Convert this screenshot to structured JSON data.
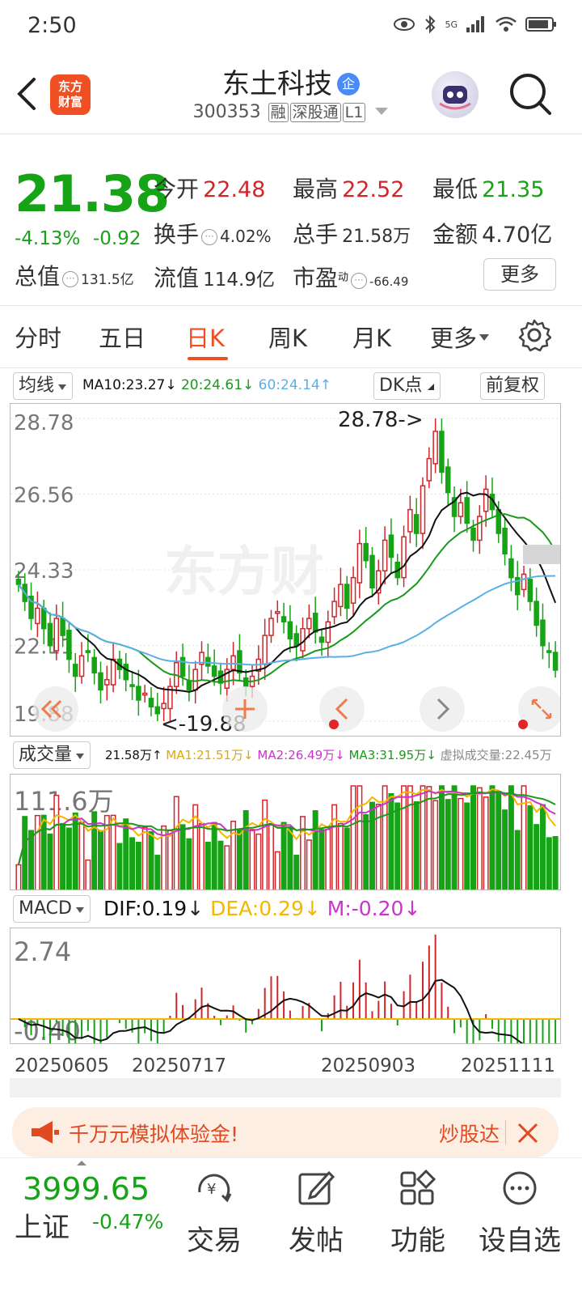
{
  "status_bar": {
    "time": "2:50",
    "network": "5G"
  },
  "header": {
    "logo_text": "东方财富",
    "stock_name": "东土科技",
    "badge": "企",
    "stock_code": "300353",
    "tags": [
      "融",
      "深股通",
      "L1"
    ]
  },
  "quote": {
    "price": "21.38",
    "change_pct": "-4.13%",
    "change_val": "-0.92",
    "open_label": "今开",
    "open": "22.48",
    "high_label": "最高",
    "high": "22.52",
    "low_label": "最低",
    "low": "21.35",
    "turnover_label": "换手",
    "turnover": "4.02%",
    "volume_label": "总手",
    "volume": "21.58万",
    "amount_label": "金额",
    "amount": "4.70亿",
    "total_cap_label": "总值",
    "total_cap": "131.5亿",
    "float_cap_label": "流值",
    "float_cap": "114.9亿",
    "pe_label": "市盈",
    "pe_sup": "动",
    "pe": "-66.49",
    "more_label": "更多"
  },
  "period_tabs": [
    "分时",
    "五日",
    "日K",
    "周K",
    "月K",
    "更多"
  ],
  "kline": {
    "ma_selector": "均线",
    "ma10": "MA10:23.27",
    "ma20": "20:24.61",
    "ma60": "60:24.14",
    "dk_label": "DK点",
    "adjust_label": "前复权",
    "y_labels": [
      "28.78",
      "26.56",
      "24.33",
      "22.11",
      "19.88"
    ],
    "high_marker": "28.78->",
    "low_marker": "<-19.88",
    "watermark": "东方财"
  },
  "volume": {
    "selector": "成交量",
    "current": "21.58万",
    "ma1": "MA1:21.51万",
    "ma2": "MA2:26.49万",
    "ma3": "MA3:31.95万",
    "virtual": "虚拟成交量:22.45万",
    "y_top": "111.6万"
  },
  "macd": {
    "selector": "MACD",
    "dif": "DIF:0.19",
    "dea": "DEA:0.29",
    "m": "M:-0.20",
    "y_top": "2.74",
    "y_bottom": "-0.40"
  },
  "x_dates": [
    "20250605",
    "20250717",
    "20250903",
    "20251111"
  ],
  "promo": {
    "text": "千万元模拟体验金!",
    "right": "炒股达"
  },
  "bottom_nav": {
    "index_value": "3999.65",
    "index_name": "上证",
    "index_change": "-0.47%",
    "items": [
      "交易",
      "发帖",
      "功能",
      "设自选"
    ]
  },
  "colors": {
    "up": "#d0262b",
    "down": "#16a316",
    "accent": "#f04e23",
    "ma10": "#111111",
    "ma20": "#1a9a1a",
    "ma60": "#5ab0e6",
    "ma1": "#f2b800",
    "ma2": "#cc33cc"
  },
  "chart_data": {
    "type": "candlestick",
    "price_range": [
      19.88,
      28.78
    ],
    "series": [
      {
        "name": "MA10",
        "values": []
      },
      {
        "name": "MA20",
        "values": []
      },
      {
        "name": "60",
        "values": []
      }
    ],
    "close_path": [
      23.9,
      23.4,
      22.9,
      23.2,
      22.6,
      22.1,
      22.9,
      22.4,
      21.7,
      21.2,
      21.8,
      21.9,
      21.3,
      20.8,
      21.1,
      21.7,
      21.4,
      21.1,
      20.9,
      20.5,
      20.7,
      20.3,
      20.1,
      20.4,
      20.9,
      21.6,
      21.2,
      20.8,
      21.4,
      21.9,
      21.5,
      21.2,
      21.0,
      21.4,
      21.8,
      21.3,
      20.9,
      21.2,
      21.7,
      22.4,
      22.9,
      23.1,
      22.8,
      22.3,
      22.1,
      22.6,
      22.9,
      22.5,
      22.2,
      22.8,
      23.4,
      23.9,
      23.2,
      24.1,
      25.1,
      24.6,
      23.8,
      24.3,
      25.2,
      24.7,
      24.1,
      25.3,
      26.1,
      25.4,
      26.8,
      27.6,
      28.4,
      27.2,
      26.6,
      25.9,
      26.3,
      25.7,
      25.2,
      25.9,
      26.7,
      26.1,
      25.4,
      24.8,
      24.1,
      23.6,
      24.2,
      23.4,
      22.7,
      22.1,
      21.9,
      21.38
    ],
    "volume_ma_series": [
      "MA1",
      "MA2",
      "MA3"
    ],
    "macd_range": [
      -0.4,
      2.74
    ]
  }
}
